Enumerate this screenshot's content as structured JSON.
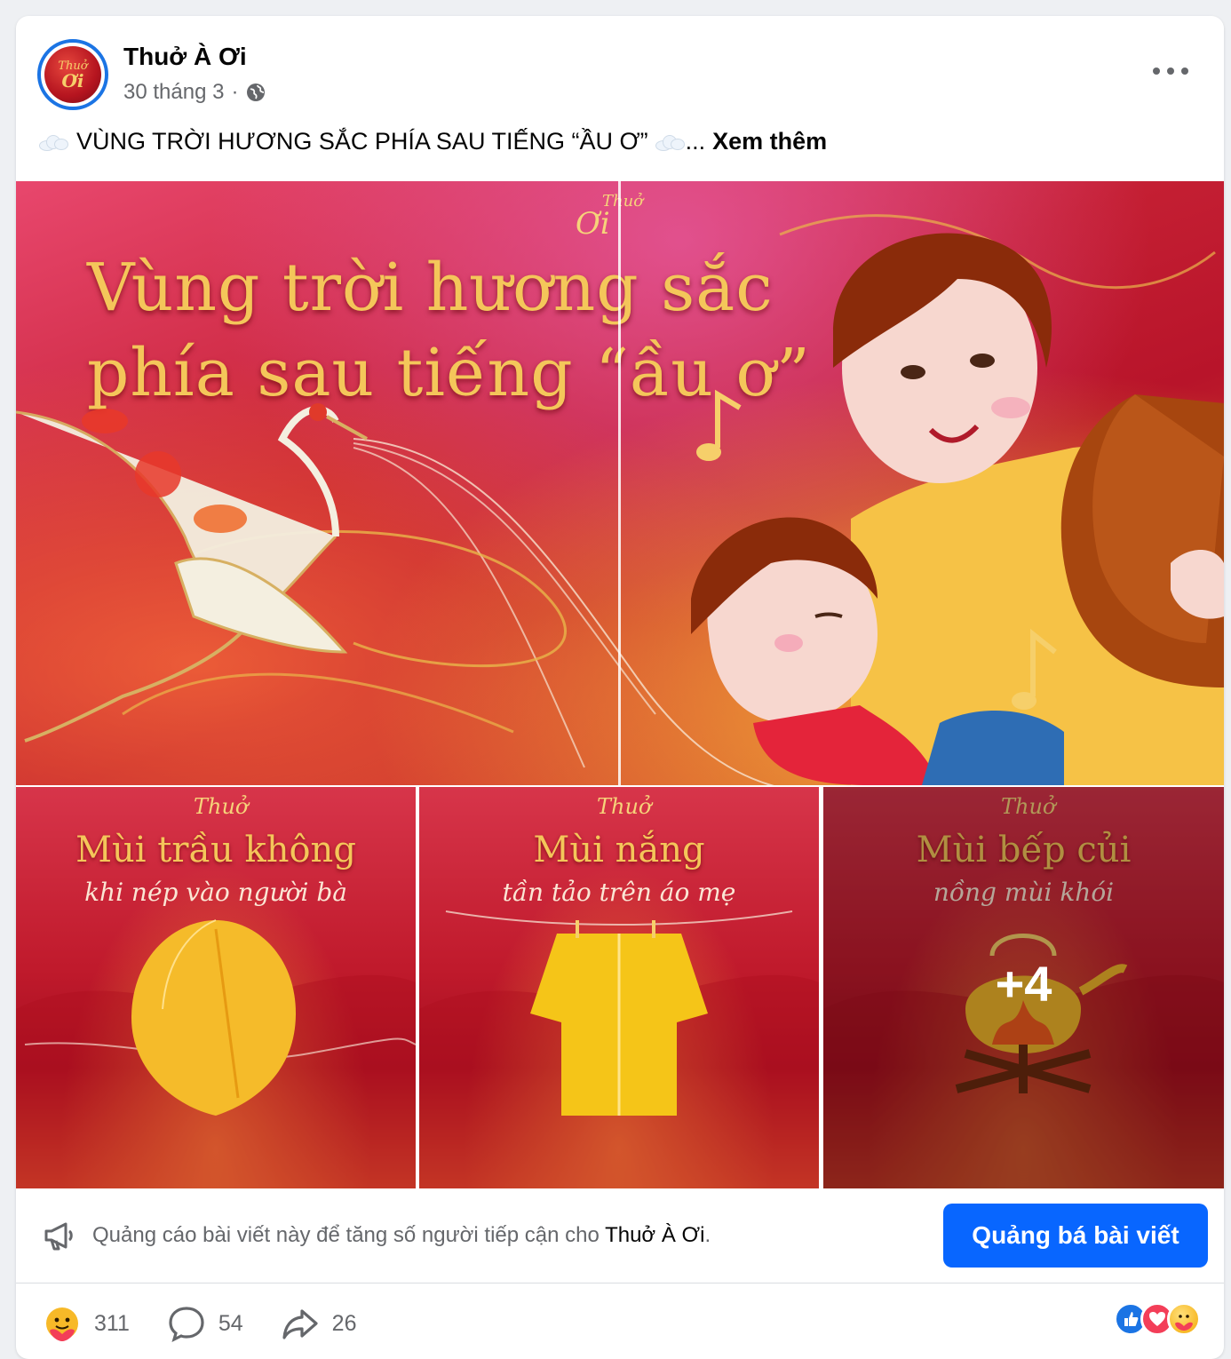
{
  "post": {
    "page_name": "Thuở À Ơi",
    "date": "30 tháng 3",
    "separator": "·",
    "privacy_icon": "globe-icon",
    "caption_text": "VÙNG TRỜI HƯƠNG SẮC PHÍA SAU TIẾNG “ẦU Ơ”",
    "caption_ellipsis": "...",
    "see_more_label": "Xem thêm",
    "caption_emoji": "cloud-icon"
  },
  "avatar": {
    "line1": "Thuở",
    "line2": "Ơi"
  },
  "images": {
    "main": {
      "brand_top": "Thuở",
      "brand_bottom": "Ơi",
      "title_line1": "Vùng trời hương sắc",
      "title_line2": "phía sau tiếng “ầu ơ”"
    },
    "tiles": [
      {
        "brand": "Thuở",
        "title": "Mùi trầu không",
        "subtitle": "khi nép vào người bà",
        "art": "betel-leaf"
      },
      {
        "brand": "Thuở",
        "title": "Mùi nắng",
        "subtitle": "tần tảo trên áo mẹ",
        "art": "shirt"
      },
      {
        "brand": "Thuở",
        "title": "Mùi bếp củi",
        "subtitle": "nồng mùi khói",
        "art": "kettle-fire",
        "more_count": "+4"
      }
    ]
  },
  "promo": {
    "text_prefix": "Quảng cáo bài viết này để tăng số người tiếp cận cho",
    "page_name": "Thuở À Ơi",
    "text_suffix": ".",
    "button_label": "Quảng bá bài viết",
    "icon": "megaphone-icon"
  },
  "engagement": {
    "reactions_count": "311",
    "comments_count": "54",
    "shares_count": "26",
    "reaction_types": [
      "like",
      "love",
      "care"
    ]
  },
  "colors": {
    "accent": "#0866ff",
    "avatar_ring": "#1b74e4",
    "secondary_text": "#65676b",
    "gold": "#f4c65a"
  }
}
